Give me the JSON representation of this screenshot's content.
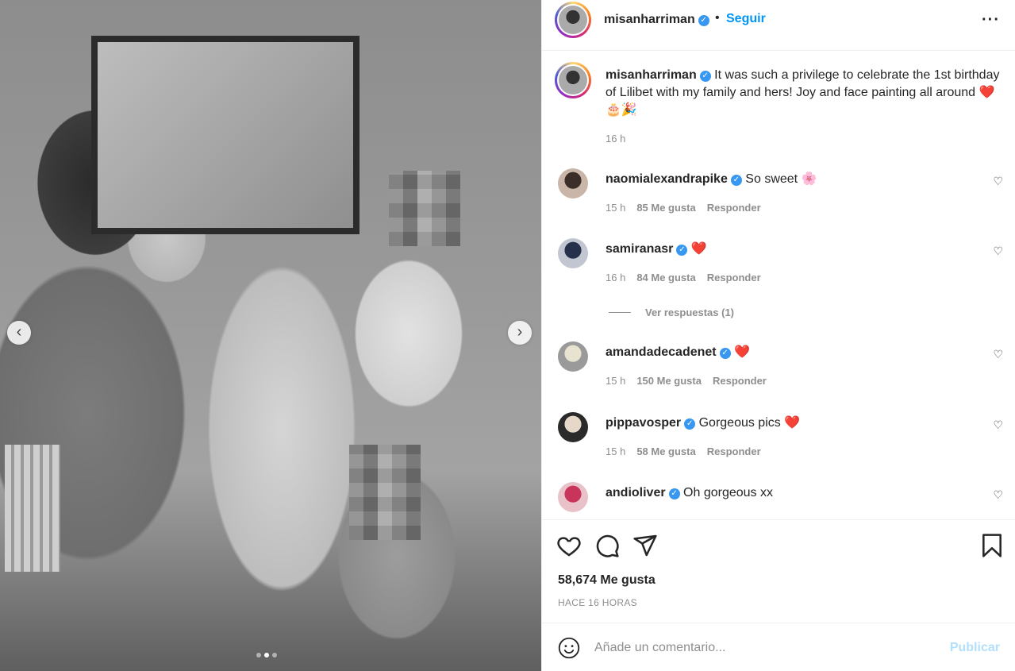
{
  "colors": {
    "accent": "#0095f6",
    "muted": "#8e8e8e",
    "heart": "#e0262e",
    "publish_disabled": "#b2dffc",
    "verified": "#3897f0"
  },
  "photo": {
    "alt_icon_prev": "chevron-left-icon",
    "alt_icon_next": "chevron-right-icon",
    "carousel_active_index": 1,
    "carousel_count": 3
  },
  "header": {
    "username": "misanharriman",
    "separator": "•",
    "follow_label": "Seguir",
    "more_icon": "more-horizontal-icon"
  },
  "caption": {
    "username": "misanharriman",
    "text": "It was such a privilege to celebrate the 1st birthday of Lilibet with my family and hers! Joy and face painting all around",
    "emojis": "❤️🎂🎉",
    "time": "16 h"
  },
  "comments": [
    {
      "username": "naomialexandrapike",
      "text": "So sweet 🌸",
      "time": "15 h",
      "likes": "85 Me gusta",
      "reply": "Responder"
    },
    {
      "username": "samiranasr",
      "text": "❤️",
      "time": "16 h",
      "likes": "84 Me gusta",
      "reply": "Responder"
    },
    {
      "username": "amandadecadenet",
      "text": "❤️",
      "time": "15 h",
      "likes": "150 Me gusta",
      "reply": "Responder"
    },
    {
      "username": "pippavosper",
      "text": "Gorgeous pics ❤️",
      "time": "15 h",
      "likes": "58 Me gusta",
      "reply": "Responder"
    },
    {
      "username": "andioliver",
      "text": "Oh gorgeous xx"
    }
  ],
  "view_replies": "Ver respuestas (1)",
  "actions": {
    "like_icon": "heart-icon",
    "comment_icon": "comment-icon",
    "share_icon": "send-icon",
    "save_icon": "bookmark-icon"
  },
  "likes_count": "58,674 Me gusta",
  "post_time": "HACE 16 HORAS",
  "comment_box": {
    "placeholder": "Añade un comentario...",
    "publish_label": "Publicar",
    "emoji_icon": "smiley-icon"
  }
}
